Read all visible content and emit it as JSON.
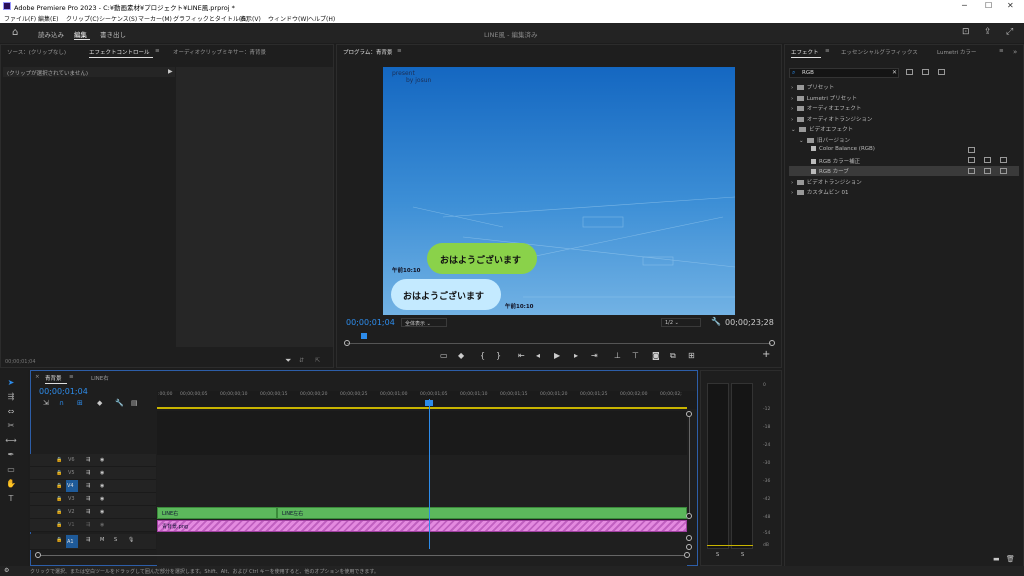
{
  "window": {
    "title": "Adobe Premiere Pro 2023 - C:¥動画素材¥プロジェクト¥LINE風.prproj *"
  },
  "menu": [
    "ファイル(F)",
    "編集(E)",
    "クリップ(C)",
    "シーケンス(S)",
    "マーカー(M)",
    "グラフィックとタイトル(G)",
    "表示(V)",
    "ウィンドウ(W)",
    "ヘルプ(H)"
  ],
  "workspace": {
    "tabs": [
      "読み込み",
      "編集",
      "書き出し"
    ],
    "active": "編集",
    "title": "LINE風 - 編集済み"
  },
  "source_panel": {
    "tabs": [
      "ソース：(クリップなし)",
      "エフェクトコントロール",
      "オーディオクリップミキサー：青背景"
    ],
    "no_clip": "(クリップが選択されていません)",
    "timecode": "00;00;01;04"
  },
  "program": {
    "title": "プログラム：青背景",
    "timecode": "00;00;01;04",
    "fit": "全体表示",
    "quality": "1/2",
    "duration": "00;00;23;28",
    "video": {
      "present": "present",
      "by": "by josun",
      "bubble1": "おはようございます",
      "time1": "午前10:10",
      "bubble2": "おはようございます",
      "time2": "午前10:10"
    }
  },
  "effects": {
    "tabs": [
      "エフェクト",
      "エッセンシャルグラフィックス",
      "Lumetri カラー"
    ],
    "search": "RGB",
    "tree": [
      "プリセット",
      "Lumetri プリセット",
      "オーディオエフェクト",
      "オーディオトランジション",
      "ビデオエフェクト",
      "旧バージョン",
      "Color Balance (RGB)",
      "RGB カラー補正",
      "RGB カーブ",
      "ビデオトランジション",
      "カスタムビン 01"
    ]
  },
  "timeline": {
    "tabs": [
      "青背景",
      "LINE右"
    ],
    "timecode": "00;00;01;04",
    "ruler": [
      ":00;00",
      "00;00;00;05",
      "00;00;00;10",
      "00;00;00;15",
      "00;00;00;20",
      "00;00;00;25",
      "00;00;01;00",
      "00;00;01;05",
      "00;00;01;10",
      "00;00;01;15",
      "00;00;01;20",
      "00;00;01;25",
      "00;00;02;00",
      "00;00;02;"
    ],
    "tracks": [
      "V6",
      "V5",
      "V4",
      "V3",
      "V2",
      "V1",
      "A1"
    ],
    "clips": {
      "v2a": "LINE右",
      "v2b": "LINE左右",
      "v1": "青背景.png"
    },
    "playhead_fraction": 0.52
  },
  "meter": {
    "scale": [
      "0",
      "-12",
      "-18",
      "-24",
      "-30",
      "-36",
      "-42",
      "-48",
      "-54",
      "-60",
      "dB"
    ],
    "solo": "S"
  },
  "status": "クリックで選択、または空白ツールをドラッグして囲んだ部分を選択します。Shift、Alt、および Ctrl キーを使用すると、他のオプションを使用できます。",
  "colors": {
    "accent": "#2d8ceb",
    "clip_green": "#5cb85c",
    "clip_pink": "#e48ae0",
    "bubble_green": "#8ad24a",
    "bubble_blue": "#c4eaff"
  }
}
